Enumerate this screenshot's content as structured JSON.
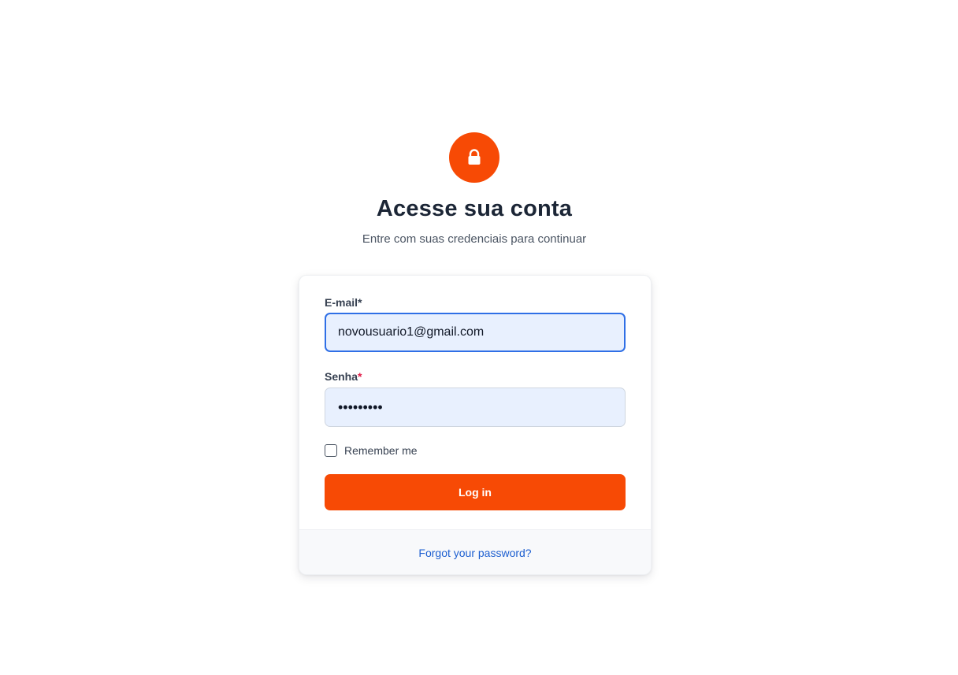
{
  "header": {
    "icon": "lock-icon",
    "title": "Acesse sua conta",
    "subtitle": "Entre com suas credenciais para continuar"
  },
  "form": {
    "email": {
      "label": "E-mail",
      "required_mark": "*",
      "value": "novousuario1@gmail.com"
    },
    "password": {
      "label": "Senha",
      "required_mark": "*",
      "masked_value": "•••••••••"
    },
    "remember_me": {
      "label": "Remember me",
      "checked": false
    },
    "submit_label": "Log in"
  },
  "footer": {
    "forgot_password": "Forgot your password?"
  },
  "colors": {
    "accent": "#f74a05",
    "focus_border": "#2f6fe6",
    "link": "#1d5fd0",
    "required_red": "#e11d48"
  }
}
